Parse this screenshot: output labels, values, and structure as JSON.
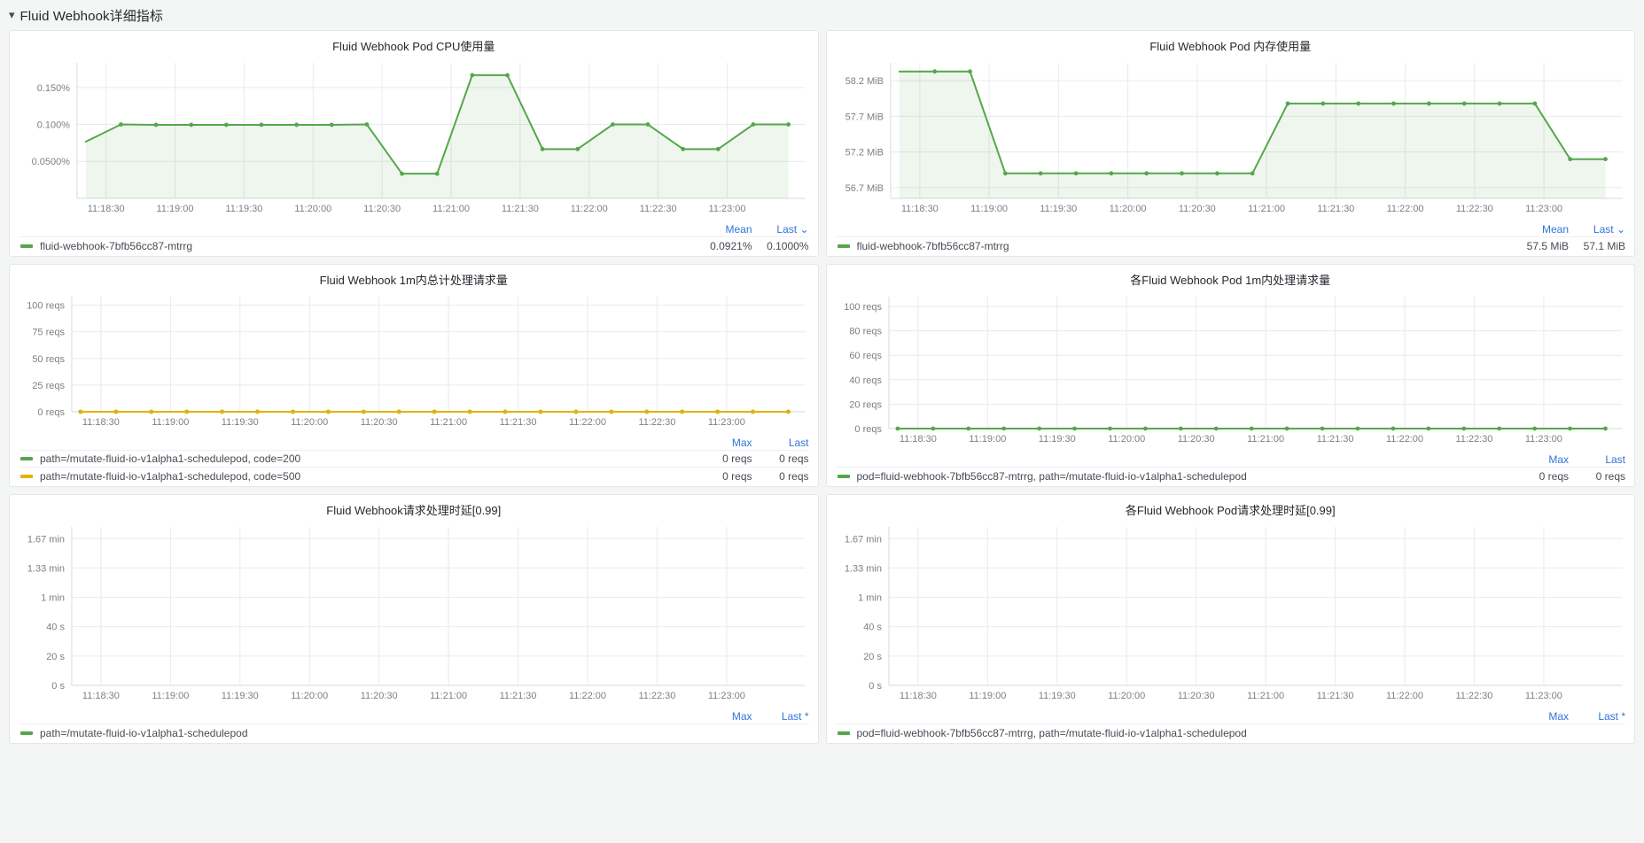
{
  "row": {
    "title": "Fluid Webhook详细指标",
    "chevron": "chevron-down",
    "collapsed": false
  },
  "colors": {
    "green": "#56A64B",
    "green_fill": "#56A64B",
    "yellow": "#E0B400",
    "link_blue": "#3274D9",
    "panel_bg": "#FFFFFF",
    "page_bg": "#F4F5F5",
    "text": "#464c54",
    "grid": "#E8EAED"
  },
  "panels": [
    {
      "id": "cpu",
      "title": "Fluid Webhook Pod CPU使用量",
      "legend_head": [
        "Mean",
        "Last"
      ],
      "last_has_caret": true,
      "series": [
        {
          "label": "fluid-webhook-7bfb56cc87-mtrrg",
          "color": "#56A64B",
          "values": [
            "0.0921%",
            "0.1000%"
          ]
        }
      ]
    },
    {
      "id": "mem",
      "title": "Fluid Webhook Pod 内存使用量",
      "legend_head": [
        "Mean",
        "Last"
      ],
      "last_has_caret": true,
      "series": [
        {
          "label": "fluid-webhook-7bfb56cc87-mtrrg",
          "color": "#56A64B",
          "values": [
            "57.5 MiB",
            "57.1 MiB"
          ]
        }
      ]
    },
    {
      "id": "reqs-total",
      "title": "Fluid Webhook 1m内总计处理请求量",
      "legend_head": [
        "Max",
        "Last"
      ],
      "last_has_caret": false,
      "series": [
        {
          "label": "path=/mutate-fluid-io-v1alpha1-schedulepod, code=200",
          "color": "#56A64B",
          "values": [
            "0 reqs",
            "0 reqs"
          ]
        },
        {
          "label": "path=/mutate-fluid-io-v1alpha1-schedulepod, code=500",
          "color": "#E0B400",
          "values": [
            "0 reqs",
            "0 reqs"
          ]
        }
      ]
    },
    {
      "id": "reqs-per-pod",
      "title": "各Fluid Webhook Pod 1m内处理请求量",
      "legend_head": [
        "Max",
        "Last"
      ],
      "last_has_caret": false,
      "series": [
        {
          "label": "pod=fluid-webhook-7bfb56cc87-mtrrg, path=/mutate-fluid-io-v1alpha1-schedulepod",
          "color": "#56A64B",
          "values": [
            "0 reqs",
            "0 reqs"
          ]
        }
      ]
    },
    {
      "id": "latency",
      "title": "Fluid Webhook请求处理时延[0.99]",
      "legend_head": [
        "Max",
        "Last *"
      ],
      "last_has_caret": false,
      "series": [
        {
          "label": "path=/mutate-fluid-io-v1alpha1-schedulepod",
          "color": "#56A64B",
          "values": [
            "",
            ""
          ]
        }
      ]
    },
    {
      "id": "latency-per-pod",
      "title": "各Fluid Webhook Pod请求处理时延[0.99]",
      "legend_head": [
        "Max",
        "Last *"
      ],
      "last_has_caret": false,
      "series": [
        {
          "label": "pod=fluid-webhook-7bfb56cc87-mtrrg, path=/mutate-fluid-io-v1alpha1-schedulepod",
          "color": "#56A64B",
          "values": [
            "",
            ""
          ]
        }
      ]
    }
  ],
  "chart_data": [
    {
      "type": "line",
      "panel": "cpu",
      "title": "Fluid Webhook Pod CPU使用量",
      "xlabel": "",
      "ylabel": "",
      "ytick_labels": [
        "0.0500%",
        "0.100%",
        "0.150%"
      ],
      "ytick_values": [
        0.05,
        0.1,
        0.15
      ],
      "ylim": [
        0.0,
        0.1833
      ],
      "grid": true,
      "legend_position": "bottom",
      "xtick_labels": [
        "11:18:30",
        "11:19:00",
        "11:19:30",
        "11:20:00",
        "11:20:30",
        "11:21:00",
        "11:21:30",
        "11:22:00",
        "11:22:30",
        "11:23:00"
      ],
      "series": [
        {
          "name": "fluid-webhook-7bfb56cc87-mtrrg",
          "color": "#56A64B",
          "x": [
            "11:18:15",
            "11:18:30",
            "11:18:45",
            "11:19:00",
            "11:19:15",
            "11:19:30",
            "11:19:45",
            "11:20:00",
            "11:20:15",
            "11:20:30",
            "11:20:45",
            "11:21:00",
            "11:21:15",
            "11:21:30",
            "11:21:45",
            "11:22:00",
            "11:22:15",
            "11:22:30",
            "11:22:45",
            "11:23:00",
            "11:23:15"
          ],
          "values": [
            0.0767,
            0.1,
            0.0995,
            0.0995,
            0.0995,
            0.0995,
            0.0995,
            0.0995,
            0.1,
            0.0333,
            0.0333,
            0.1667,
            0.1667,
            0.0667,
            0.0667,
            0.1,
            0.1,
            0.0667,
            0.0667,
            0.1,
            0.1
          ]
        }
      ]
    },
    {
      "type": "line",
      "panel": "mem",
      "title": "Fluid Webhook Pod 内存使用量",
      "xlabel": "",
      "ylabel": "",
      "ytick_labels": [
        "56.7 MiB",
        "57.2 MiB",
        "57.7 MiB",
        "58.2 MiB"
      ],
      "ytick_values": [
        56.7,
        57.2,
        57.7,
        58.2
      ],
      "ylim": [
        56.55,
        58.45
      ],
      "grid": true,
      "legend_position": "bottom",
      "xtick_labels": [
        "11:18:30",
        "11:19:00",
        "11:19:30",
        "11:20:00",
        "11:20:30",
        "11:21:00",
        "11:21:30",
        "11:22:00",
        "11:22:30",
        "11:23:00"
      ],
      "series": [
        {
          "name": "fluid-webhook-7bfb56cc87-mtrrg",
          "color": "#56A64B",
          "x": [
            "11:18:15",
            "11:18:30",
            "11:18:45",
            "11:19:00",
            "11:19:15",
            "11:19:30",
            "11:19:45",
            "11:20:00",
            "11:20:15",
            "11:20:30",
            "11:20:45",
            "11:21:00",
            "11:21:15",
            "11:21:30",
            "11:21:45",
            "11:22:00",
            "11:22:15",
            "11:22:30",
            "11:22:45",
            "11:23:00",
            "11:23:15"
          ],
          "values": [
            58.33,
            58.33,
            58.33,
            56.9,
            56.9,
            56.9,
            56.9,
            56.9,
            56.9,
            56.9,
            56.9,
            57.88,
            57.88,
            57.88,
            57.88,
            57.88,
            57.88,
            57.88,
            57.88,
            57.1,
            57.1
          ]
        }
      ]
    },
    {
      "type": "line",
      "panel": "reqs-total",
      "title": "Fluid Webhook 1m内总计处理请求量",
      "xlabel": "",
      "ylabel": "",
      "ytick_labels": [
        "0 reqs",
        "25 reqs",
        "50 reqs",
        "75 reqs",
        "100 reqs"
      ],
      "ytick_values": [
        0,
        25,
        50,
        75,
        100
      ],
      "ylim": [
        0,
        108
      ],
      "grid": true,
      "legend_position": "bottom",
      "xtick_labels": [
        "11:18:30",
        "11:19:00",
        "11:19:30",
        "11:20:00",
        "11:20:30",
        "11:21:00",
        "11:21:30",
        "11:22:00",
        "11:22:30",
        "11:23:00"
      ],
      "series": [
        {
          "name": "path=/mutate-fluid-io-v1alpha1-schedulepod, code=200",
          "color": "#56A64B",
          "values": [
            0,
            0,
            0,
            0,
            0,
            0,
            0,
            0,
            0,
            0,
            0,
            0,
            0,
            0,
            0,
            0,
            0,
            0,
            0,
            0,
            0
          ]
        },
        {
          "name": "path=/mutate-fluid-io-v1alpha1-schedulepod, code=500",
          "color": "#E0B400",
          "values": [
            0,
            0,
            0,
            0,
            0,
            0,
            0,
            0,
            0,
            0,
            0,
            0,
            0,
            0,
            0,
            0,
            0,
            0,
            0,
            0,
            0
          ]
        }
      ]
    },
    {
      "type": "line",
      "panel": "reqs-per-pod",
      "title": "各Fluid Webhook Pod 1m内处理请求量",
      "xlabel": "",
      "ylabel": "",
      "ytick_labels": [
        "0 reqs",
        "20 reqs",
        "40 reqs",
        "60 reqs",
        "80 reqs",
        "100 reqs"
      ],
      "ytick_values": [
        0,
        20,
        40,
        60,
        80,
        100
      ],
      "ylim": [
        0,
        108
      ],
      "grid": true,
      "legend_position": "bottom",
      "xtick_labels": [
        "11:18:30",
        "11:19:00",
        "11:19:30",
        "11:20:00",
        "11:20:30",
        "11:21:00",
        "11:21:30",
        "11:22:00",
        "11:22:30",
        "11:23:00"
      ],
      "series": [
        {
          "name": "pod=fluid-webhook-7bfb56cc87-mtrrg, path=/mutate-fluid-io-v1alpha1-schedulepod",
          "color": "#56A64B",
          "values": [
            0,
            0,
            0,
            0,
            0,
            0,
            0,
            0,
            0,
            0,
            0,
            0,
            0,
            0,
            0,
            0,
            0,
            0,
            0,
            0,
            0
          ]
        }
      ]
    },
    {
      "type": "line",
      "panel": "latency",
      "title": "Fluid Webhook请求处理时延[0.99]",
      "xlabel": "",
      "ylabel": "",
      "ytick_labels": [
        "0 s",
        "20 s",
        "40 s",
        "1 min",
        "1.33 min",
        "1.67 min"
      ],
      "ytick_values": [
        0,
        20,
        40,
        60,
        80,
        100
      ],
      "ylim": [
        0,
        108
      ],
      "grid": true,
      "legend_position": "bottom",
      "xtick_labels": [
        "11:18:30",
        "11:19:00",
        "11:19:30",
        "11:20:00",
        "11:20:30",
        "11:21:00",
        "11:21:30",
        "11:22:00",
        "11:22:30",
        "11:23:00"
      ],
      "series": [
        {
          "name": "path=/mutate-fluid-io-v1alpha1-schedulepod",
          "color": "#56A64B",
          "values": []
        }
      ]
    },
    {
      "type": "line",
      "panel": "latency-per-pod",
      "title": "各Fluid Webhook Pod请求处理时延[0.99]",
      "xlabel": "",
      "ylabel": "",
      "ytick_labels": [
        "0 s",
        "20 s",
        "40 s",
        "1 min",
        "1.33 min",
        "1.67 min"
      ],
      "ytick_values": [
        0,
        20,
        40,
        60,
        80,
        100
      ],
      "ylim": [
        0,
        108
      ],
      "grid": true,
      "legend_position": "bottom",
      "xtick_labels": [
        "11:18:30",
        "11:19:00",
        "11:19:30",
        "11:20:00",
        "11:20:30",
        "11:21:00",
        "11:21:30",
        "11:22:00",
        "11:22:30",
        "11:23:00"
      ],
      "series": [
        {
          "name": "pod=fluid-webhook-7bfb56cc87-mtrrg, path=/mutate-fluid-io-v1alpha1-schedulepod",
          "color": "#56A64B",
          "values": []
        }
      ]
    }
  ]
}
